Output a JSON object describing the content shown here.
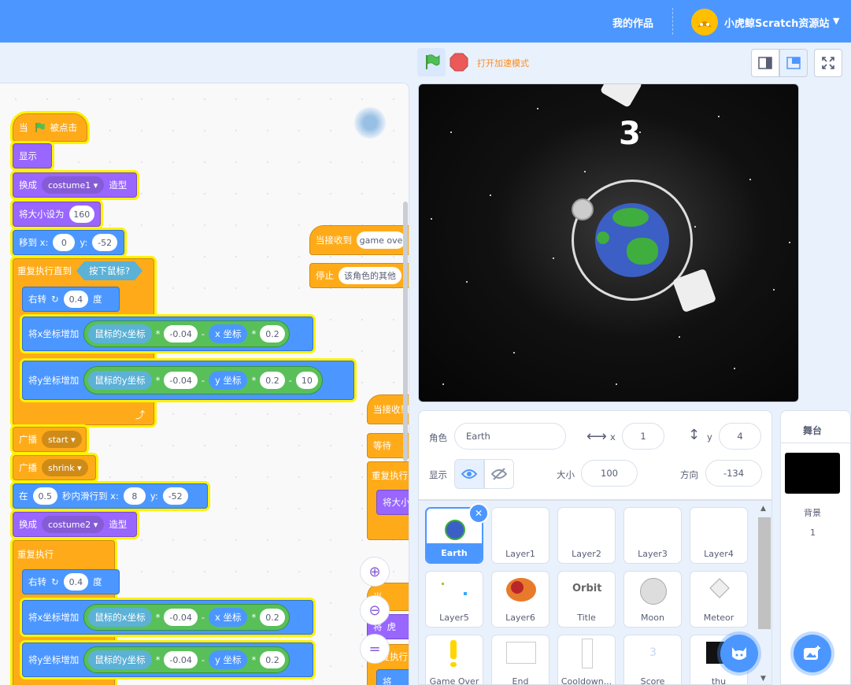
{
  "menu": {
    "my_projects": "我的作品",
    "username": "小虎鲸Scratch资源站"
  },
  "controls": {
    "turbo_label": "打开加速模式"
  },
  "stage": {
    "score": "3"
  },
  "code": {
    "hat": {
      "when": "当",
      "clicked": "被点击"
    },
    "show": "显示",
    "switch1": {
      "pre": "换成",
      "costume": "costume1",
      "post": "造型"
    },
    "setsize": {
      "label": "将大小设为",
      "value": "160"
    },
    "goto": {
      "pre": "移到 x:",
      "x": "0",
      "ymid": "y:",
      "y": "-52"
    },
    "repeat_until": {
      "label": "重复执行直到",
      "cond": "按下鼠标?"
    },
    "turn1": {
      "pre": "右转",
      "val": "0.4",
      "post": "度"
    },
    "changex1": {
      "label": "将x坐标增加",
      "mouse": "鼠标的x坐标",
      "k": "-0.04",
      "minus": "-",
      "pos": "x 坐标",
      "mul": "*",
      "f": "0.2"
    },
    "changey1": {
      "label": "将y坐标增加",
      "mouse": "鼠标的y坐标",
      "k": "-0.04",
      "minus": "-",
      "pos": "y 坐标",
      "mul": "*",
      "f": "0.2",
      "minus2": "-",
      "off": "10"
    },
    "broadcast1": {
      "label": "广播",
      "msg": "start"
    },
    "broadcast2": {
      "label": "广播",
      "msg": "shrink"
    },
    "glide": {
      "pre": "在",
      "t": "0.5",
      "mid": "秒内滑行到 x:",
      "x": "8",
      "ymid": "y:",
      "y": "-52"
    },
    "switch2": {
      "pre": "换成",
      "costume": "costume2",
      "post": "造型"
    },
    "forever": "重复执行",
    "turn2": {
      "pre": "右转",
      "val": "0.4",
      "post": "度"
    },
    "changex2": {
      "label": "将x坐标增加",
      "mouse": "鼠标的x坐标",
      "k": "-0.04",
      "minus": "-",
      "pos": "x 坐标",
      "mul": "*",
      "f": "0.2"
    },
    "changey2": {
      "label": "将y坐标增加",
      "mouse": "鼠标的y坐标",
      "k": "-0.04",
      "minus": "-",
      "pos": "y 坐标",
      "mul": "*",
      "f": "0.2"
    },
    "recv1": {
      "label": "当接收到",
      "msg": "game ove"
    },
    "stop": {
      "label": "停止",
      "opt": "该角色的其他"
    },
    "recv2": "当接收到",
    "wait": "等待",
    "rep2": "重复执行",
    "setsize2": "将大小",
    "hat2": "当",
    "jiang": "将",
    "hu": "虎",
    "chongfu": "重复执行",
    "jiang2": "将"
  },
  "sprite_info": {
    "sprite_label": "角色",
    "name": "Earth",
    "x_label": "x",
    "x": "1",
    "y_label": "y",
    "y": "4",
    "show_label": "显示",
    "size_label": "大小",
    "size": "100",
    "dir_label": "方向",
    "direction": "-134"
  },
  "sprites": [
    "Earth",
    "Layer1",
    "Layer2",
    "Layer3",
    "Layer4",
    "Layer5",
    "Layer6",
    "Title",
    "Moon",
    "Meteor",
    "Game Over",
    "End",
    "Cooldown...",
    "Score",
    "thu"
  ],
  "thumbs": {
    "title_text": "Orbit",
    "score_digit": "3"
  },
  "stage_pane": {
    "title": "舞台",
    "bg_label": "背景",
    "bg_count": "1"
  },
  "colors": {
    "accent": "#4c97ff",
    "events": "#ffab19",
    "looks": "#9966ff",
    "motion": "#4c97ff",
    "operators": "#59c059",
    "sensing": "#5cb1d6"
  }
}
